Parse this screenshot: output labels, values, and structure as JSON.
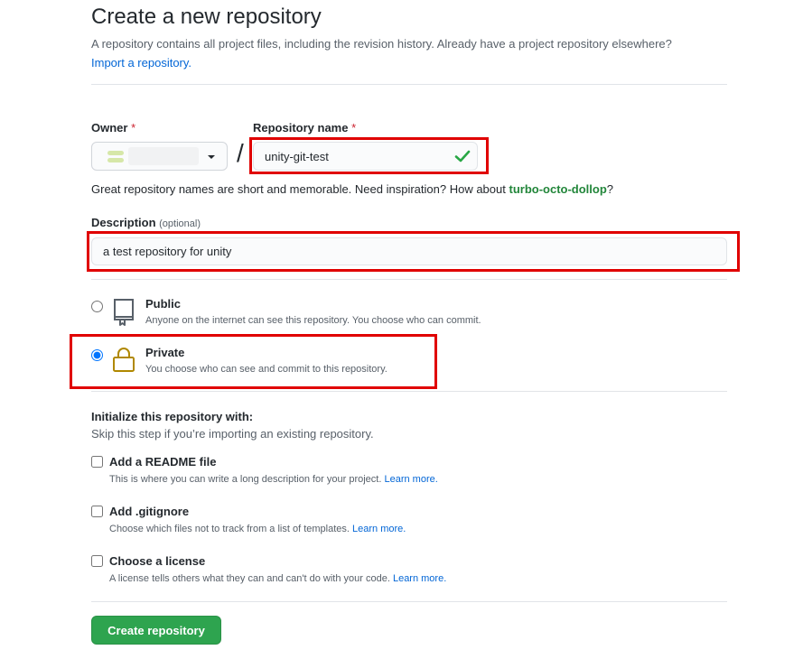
{
  "header": {
    "title": "Create a new repository",
    "subtitle": "A repository contains all project files, including the revision history. Already have a project repository elsewhere?",
    "import_link": "Import a repository."
  },
  "owner": {
    "label": "Owner",
    "required_mark": "*"
  },
  "repo_name": {
    "label": "Repository name",
    "required_mark": "*",
    "value": "unity-git-test",
    "separator": "/",
    "hint_prefix": "Great repository names are short and memorable. Need inspiration? How about",
    "suggestion": "turbo-octo-dollop",
    "hint_suffix": "?"
  },
  "description": {
    "label": "Description",
    "optional": "(optional)",
    "value": "a test repository for unity"
  },
  "visibility": {
    "selected": "private",
    "public": {
      "title": "Public",
      "desc": "Anyone on the internet can see this repository. You choose who can commit."
    },
    "private": {
      "title": "Private",
      "desc": "You choose who can see and commit to this repository."
    }
  },
  "init": {
    "title": "Initialize this repository with:",
    "subtitle": "Skip this step if you’re importing an existing repository.",
    "learn_more": "Learn more.",
    "readme": {
      "title": "Add a README file",
      "desc": "This is where you can write a long description for your project."
    },
    "gitignore": {
      "title": "Add .gitignore",
      "desc": "Choose which files not to track from a list of templates."
    },
    "license": {
      "title": "Choose a license",
      "desc": "A license tells others what they can and can't do with your code."
    }
  },
  "submit": {
    "label": "Create repository"
  },
  "colors": {
    "accent_green": "#2ea44f",
    "link_blue": "#0366d6",
    "annotation_red": "#e00000",
    "private_icon": "#b08800"
  }
}
